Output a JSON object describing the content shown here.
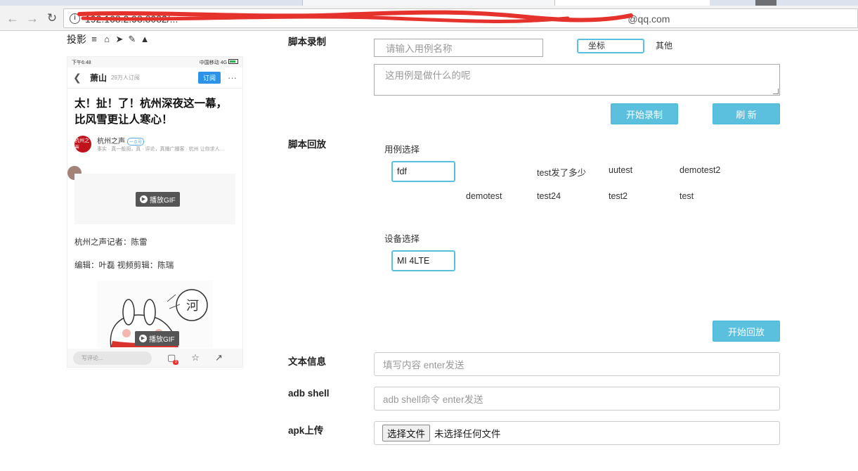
{
  "browser": {
    "url_visible_start": "192.168.2.98:8082/...",
    "url_visible_end": "@qq.com"
  },
  "phone_panel": {
    "cast_label": "投影",
    "status_time": "下午6:48",
    "status_right": "中国移动 4G",
    "channel": "萧山",
    "fans": "29万人订阅",
    "subscribe": "订阅",
    "more": "···",
    "title": "太！扯！了！杭州深夜这一幕，比风雪更让人寒心！",
    "author_avatar": "杭州之声",
    "author_name": "杭州之声",
    "author_badge": "一点号",
    "author_desc": "事实 · 真一般阅，真 · 评论，真播广播客 · 杭州 让你求人…",
    "gif_label": "播放GIF",
    "reporter": "杭州之声记者：陈雷",
    "editor": "编辑：叶磊 视频剪辑：陈瑞",
    "comment_placeholder": "写评论...",
    "comment_count": "3"
  },
  "record": {
    "label": "脚本录制",
    "case_name_placeholder": "请输入用例名称",
    "coord_label": "坐标",
    "other_label": "其他",
    "desc_placeholder": "这用例是做什么的呢",
    "start_record": "开始录制",
    "refresh": "刷 新"
  },
  "replay": {
    "label": "脚本回放",
    "case_select_label": "用例选择",
    "cases": [
      "fdf",
      "test发了多少",
      "uutest",
      "demotest2",
      "demotest",
      "test24",
      "test2",
      "test"
    ],
    "selected_case": "fdf",
    "device_select_label": "设备选择",
    "selected_device": "MI 4LTE",
    "start_replay": "开始回放"
  },
  "text_info": {
    "label": "文本信息",
    "placeholder": "填写内容 enter发送"
  },
  "adb": {
    "label": "adb shell",
    "placeholder": "adb shell命令 enter发送"
  },
  "apk": {
    "label": "apk上传",
    "choose_file": "选择文件",
    "no_file": "未选择任何文件"
  }
}
